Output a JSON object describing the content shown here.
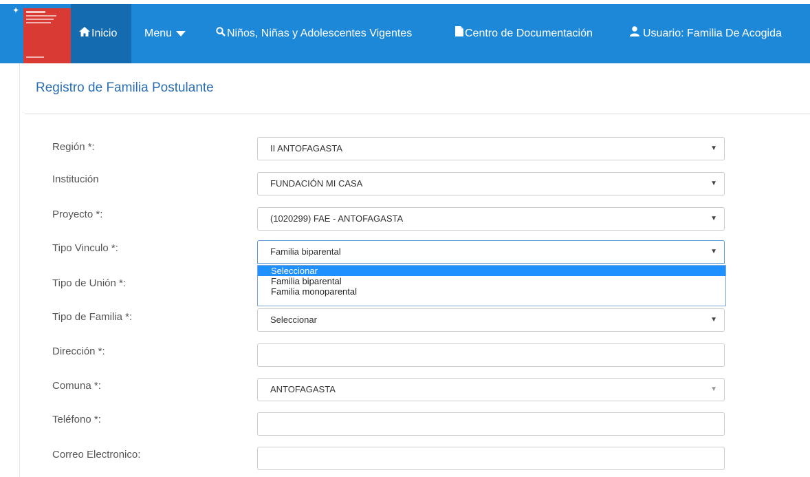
{
  "nav": {
    "inicio": "Inicio",
    "menu": "Menu",
    "ninos": "Niños, Niñas y Adolescentes Vigentes",
    "centro": "Centro de Documentación",
    "usuario": "Usuario: Familia De Acogida",
    "icons": {
      "inicio": "home-icon",
      "menu": "caret-down-icon",
      "ninos": "search-icon",
      "centro": "document-icon",
      "usuario": "user-icon"
    }
  },
  "colors": {
    "navbar": "#1e88d8",
    "nav_active": "#156bb0",
    "title": "#2a6db0",
    "dropdown_selected": "#1e90ff"
  },
  "page": {
    "title": "Registro de Familia Postulante"
  },
  "form": {
    "region": {
      "label": "Región *:",
      "value": "II ANTOFAGASTA"
    },
    "institucion": {
      "label": "Institución",
      "value": "FUNDACIÓN MI CASA"
    },
    "proyecto": {
      "label": "Proyecto *:",
      "value": "(1020299) FAE - ANTOFAGASTA"
    },
    "tipo_vinculo": {
      "label": "Tipo Vinculo *:",
      "value": "Familia biparental",
      "options": [
        "Seleccionar",
        "Familia biparental",
        "Familia monoparental"
      ],
      "highlighted": "Seleccionar"
    },
    "tipo_union": {
      "label": "Tipo de Unión *:"
    },
    "tipo_familia": {
      "label": "Tipo de Familia *:",
      "value": "Seleccionar"
    },
    "direccion": {
      "label": "Dirección *:",
      "value": ""
    },
    "comuna": {
      "label": "Comuna *:",
      "value": "ANTOFAGASTA"
    },
    "telefono": {
      "label": "Teléfono *:",
      "value": ""
    },
    "correo": {
      "label": "Correo Electronico:",
      "value": ""
    }
  }
}
